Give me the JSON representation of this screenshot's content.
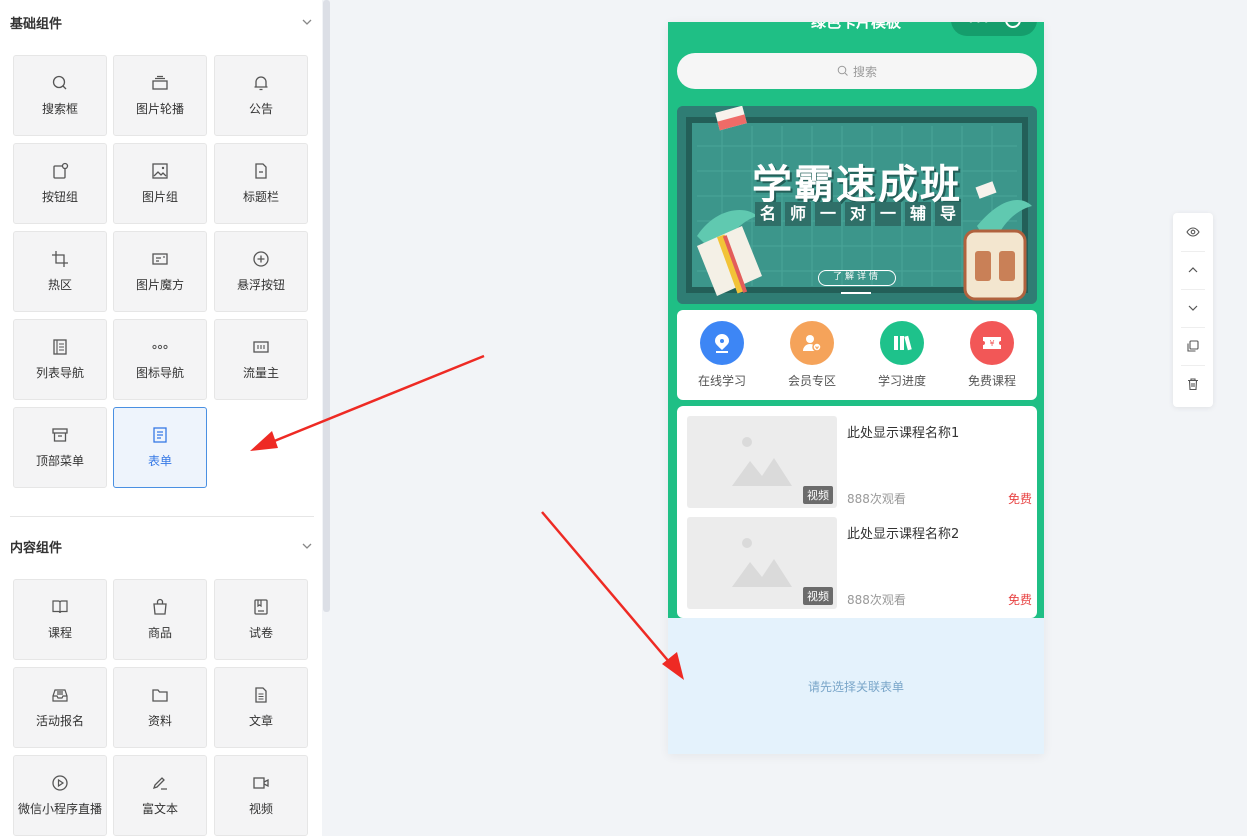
{
  "sidebar": {
    "basic_title": "基础组件",
    "content_title": "内容组件",
    "basic_items": [
      {
        "label": "搜索框",
        "icon": "search-icon"
      },
      {
        "label": "图片轮播",
        "icon": "carousel-icon"
      },
      {
        "label": "公告",
        "icon": "bell-icon"
      },
      {
        "label": "按钮组",
        "icon": "button-group-icon"
      },
      {
        "label": "图片组",
        "icon": "image-icon"
      },
      {
        "label": "标题栏",
        "icon": "document-icon"
      },
      {
        "label": "热区",
        "icon": "crop-icon"
      },
      {
        "label": "图片魔方",
        "icon": "image-cube-icon"
      },
      {
        "label": "悬浮按钮",
        "icon": "plus-circle-icon"
      },
      {
        "label": "列表导航",
        "icon": "list-icon"
      },
      {
        "label": "图标导航",
        "icon": "dots-icon"
      },
      {
        "label": "流量主",
        "icon": "ad-icon"
      },
      {
        "label": "顶部菜单",
        "icon": "archive-icon"
      },
      {
        "label": "表单",
        "icon": "form-icon",
        "active": true
      }
    ],
    "content_items": [
      {
        "label": "课程",
        "icon": "book-icon"
      },
      {
        "label": "商品",
        "icon": "bag-icon"
      },
      {
        "label": "试卷",
        "icon": "exam-icon"
      },
      {
        "label": "活动报名",
        "icon": "inbox-icon"
      },
      {
        "label": "资料",
        "icon": "folder-icon"
      },
      {
        "label": "文章",
        "icon": "article-icon"
      },
      {
        "label": "微信小程序直播",
        "icon": "play-icon"
      },
      {
        "label": "富文本",
        "icon": "pen-icon"
      },
      {
        "label": "视频",
        "icon": "video-icon"
      }
    ]
  },
  "phone": {
    "title": "绿色卡片模板",
    "capsule_dots": "•••",
    "search_placeholder": "搜索",
    "banner": {
      "title": "学霸速成班",
      "subtitle": [
        "名",
        "师",
        "一",
        "对",
        "一",
        "辅",
        "导"
      ],
      "button": "了解详情"
    },
    "nav": [
      {
        "label": "在线学习",
        "color": "#3d86f5",
        "icon": "pen-nib-icon"
      },
      {
        "label": "会员专区",
        "color": "#f5a35a",
        "icon": "member-icon"
      },
      {
        "label": "学习进度",
        "color": "#1ec28b",
        "icon": "books-icon"
      },
      {
        "label": "免费课程",
        "color": "#f25757",
        "icon": "ticket-icon"
      }
    ],
    "courses": [
      {
        "name": "此处显示课程名称1",
        "tag": "视频",
        "views": "888次观看",
        "price": "免费"
      },
      {
        "name": "此处显示课程名称2",
        "tag": "视频",
        "views": "888次观看",
        "price": "免费"
      }
    ],
    "form_placeholder": "请先选择关联表单"
  },
  "colors": {
    "accent": "#1fbf85",
    "active_border": "#4a90e2",
    "price_red": "#e84343",
    "arrow_red": "#ee2a24"
  }
}
